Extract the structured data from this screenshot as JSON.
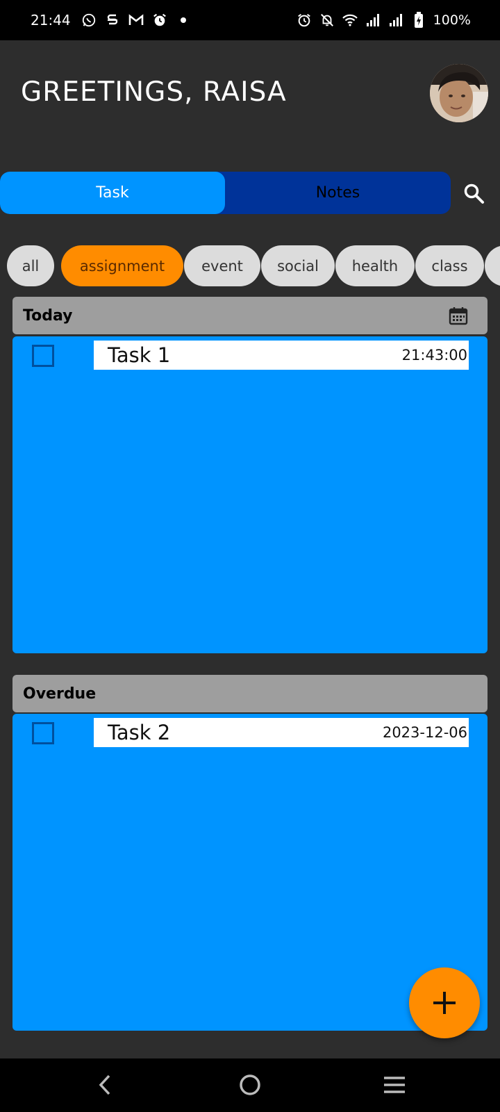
{
  "status_bar": {
    "time": "21:44",
    "battery": "100%",
    "left_icons": [
      "whatsapp-icon",
      "s-app-icon",
      "gmail-icon",
      "alarm-icon",
      "dot-icon"
    ],
    "right_icons": [
      "alarm-icon",
      "mute-icon",
      "wifi-icon",
      "signal-icon",
      "signal-icon",
      "battery-charging-icon"
    ]
  },
  "header": {
    "greeting": "GREETINGS, RAISA"
  },
  "tabs": [
    {
      "label": "Task",
      "active": true
    },
    {
      "label": "Notes",
      "active": false
    }
  ],
  "filters": [
    {
      "label": "all",
      "active": false
    },
    {
      "label": "assignment",
      "active": true
    },
    {
      "label": "event",
      "active": false
    },
    {
      "label": "social",
      "active": false
    },
    {
      "label": "health",
      "active": false
    },
    {
      "label": "class",
      "active": false
    }
  ],
  "sections": [
    {
      "title": "Today",
      "tasks": [
        {
          "name": "Task 1",
          "time": "21:43:00",
          "checked": false
        }
      ]
    },
    {
      "title": "Overdue",
      "tasks": [
        {
          "name": "Task 2",
          "time": "2023-12-06",
          "checked": false
        }
      ]
    }
  ],
  "colors": {
    "background": "#2d2d2d",
    "accent_blue": "#0094ff",
    "tab_dark_blue": "#003399",
    "accent_orange": "#ff8c00",
    "section_header": "#9e9e9e"
  }
}
